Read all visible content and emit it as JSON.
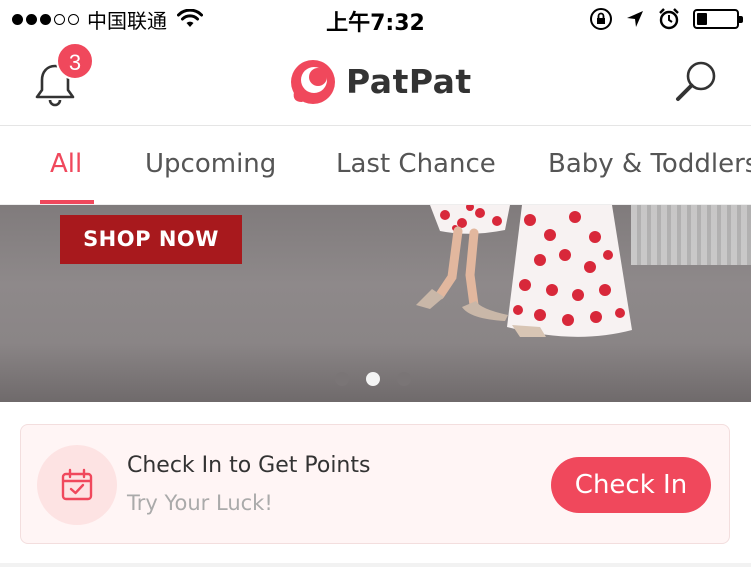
{
  "status_bar": {
    "carrier": "中国联通",
    "time": "上午7:32",
    "signal_dots_filled": 3,
    "signal_dots_total": 5,
    "icons": [
      "wifi-icon",
      "orientation-lock-icon",
      "location-arrow-icon",
      "alarm-icon",
      "battery-icon"
    ],
    "battery_level": 0.25
  },
  "header": {
    "notification_count": "3",
    "logo_text": "PatPat",
    "icons": [
      "bell-icon",
      "patpat-logo-icon",
      "search-icon"
    ]
  },
  "tabs": [
    {
      "label": "All",
      "active": true
    },
    {
      "label": "Upcoming",
      "active": false
    },
    {
      "label": "Last Chance",
      "active": false
    },
    {
      "label": "Baby & Toddlers",
      "active": false
    }
  ],
  "banner": {
    "cta_label": "SHOP NOW",
    "slide_count": 3,
    "active_slide": 2
  },
  "checkin": {
    "title": "Check In to Get Points",
    "subtitle": "Try Your Luck!",
    "button_label": "Check In",
    "icon": "calendar-check-icon"
  },
  "colors": {
    "accent": "#f0485c",
    "banner_button": "#a8191d",
    "card_background": "#fff5f5"
  }
}
